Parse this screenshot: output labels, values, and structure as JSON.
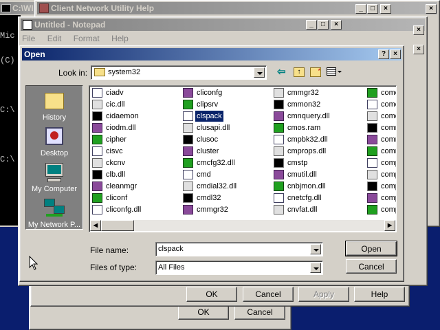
{
  "console": {
    "title": "C:\\WI",
    "lines": [
      "Mic",
      "(C)",
      "",
      "C:\\",
      "",
      "C:\\"
    ]
  },
  "help_window": {
    "title": "Client Network Utility Help"
  },
  "notepad": {
    "title": "Untitled - Notepad",
    "menu": [
      "File",
      "Edit",
      "Format",
      "Help"
    ]
  },
  "back_dialog": {
    "buttons": {
      "ok": "OK",
      "cancel": "Cancel",
      "apply": "Apply",
      "help": "Help"
    }
  },
  "rear_dialog": {
    "buttons": {
      "ok": "OK",
      "cancel": "Cancel"
    }
  },
  "open_dialog": {
    "title": "Open",
    "look_in_label": "Look in:",
    "look_in_value": "system32",
    "places": [
      {
        "label": "History",
        "icon": "history-icon"
      },
      {
        "label": "Desktop",
        "icon": "desktop-icon"
      },
      {
        "label": "My Computer",
        "icon": "my-computer-icon"
      },
      {
        "label": "My Network P...",
        "icon": "network-places-icon"
      }
    ],
    "file_columns": [
      [
        "ciadv",
        "cic.dll",
        "cidaemon",
        "ciodm.dll",
        "cipher",
        "cisvc",
        "ckcnv",
        "clb.dll",
        "cleanmgr",
        "cliconf",
        "cliconfg.dll"
      ],
      [
        "cliconfg",
        "clipsrv",
        "clspack",
        "clusapi.dll",
        "clusoc",
        "cluster",
        "cmcfg32.dll",
        "cmd",
        "cmdial32.dll",
        "cmdl32",
        "cmmgr32"
      ],
      [
        "cmmgr32",
        "cmmon32",
        "cmnquery.dll",
        "cmos.ram",
        "cmpbk32.dll",
        "cmprops.dll",
        "cmstp",
        "cmutil.dll",
        "cnbjmon.dll",
        "cnetcfg.dll",
        "cnvfat.dll"
      ],
      [
        "comca",
        "comct",
        "comdl",
        "comm",
        "comm",
        "comm",
        "comp",
        "compa",
        "compr",
        "compc",
        "comps"
      ]
    ],
    "selected_file": "clspack",
    "file_name_label": "File name:",
    "file_name_value": "clspack",
    "file_type_label": "Files of type:",
    "file_type_value": "All Files",
    "open_button": "Open",
    "cancel_button": "Cancel"
  },
  "colors": {
    "desktop": "#0a1e6e",
    "title_active": "#0a246a",
    "face": "#d4d0c8",
    "places_bar": "#808080"
  }
}
